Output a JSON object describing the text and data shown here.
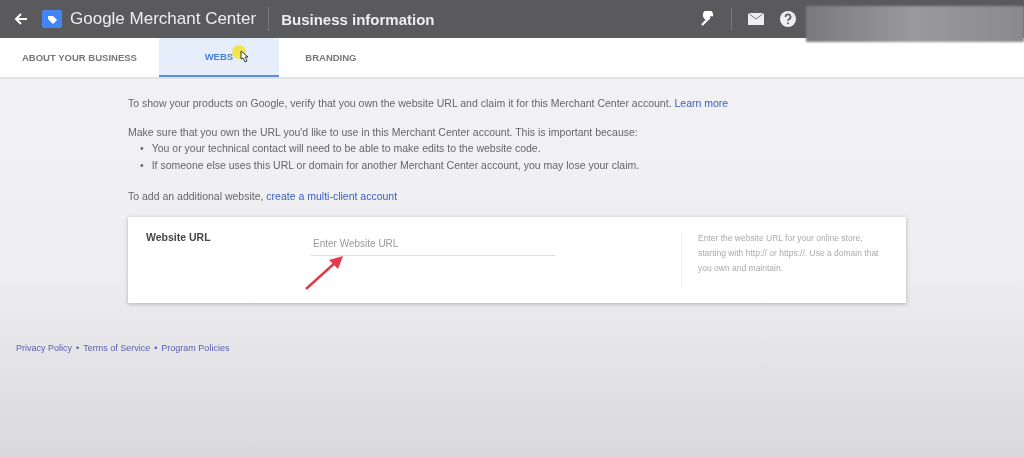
{
  "header": {
    "product": "Google Merchant Center",
    "page_title": "Business information"
  },
  "tabs": [
    {
      "label": "ABOUT YOUR BUSINESS",
      "selected": false
    },
    {
      "label": "WEBS",
      "selected": true
    },
    {
      "label": "BRANDING",
      "selected": false
    }
  ],
  "intro": {
    "text": "To show your products on Google, verify that you own the website URL and claim it for this Merchant Center account.",
    "link": "Learn more"
  },
  "notice": "Make sure that you own the URL you'd like to use in this Merchant Center account. This is important because:",
  "bullets": [
    "You or your technical contact will need to be able to make edits to the website code.",
    "If someone else uses this URL or domain for another Merchant Center account, you may lose your claim."
  ],
  "additional": {
    "text": "To add an additional website,",
    "link": "create a multi-client account"
  },
  "url_card": {
    "label": "Website URL",
    "placeholder": "Enter Website URL",
    "help": "Enter the website URL for your online store, starting with http:// or https://. Use a domain that you own and maintain."
  },
  "bullet_mark": "•",
  "footer_separator": "•",
  "footer_links": [
    "Privacy Policy",
    "Terms of Service",
    "Program Policies"
  ]
}
